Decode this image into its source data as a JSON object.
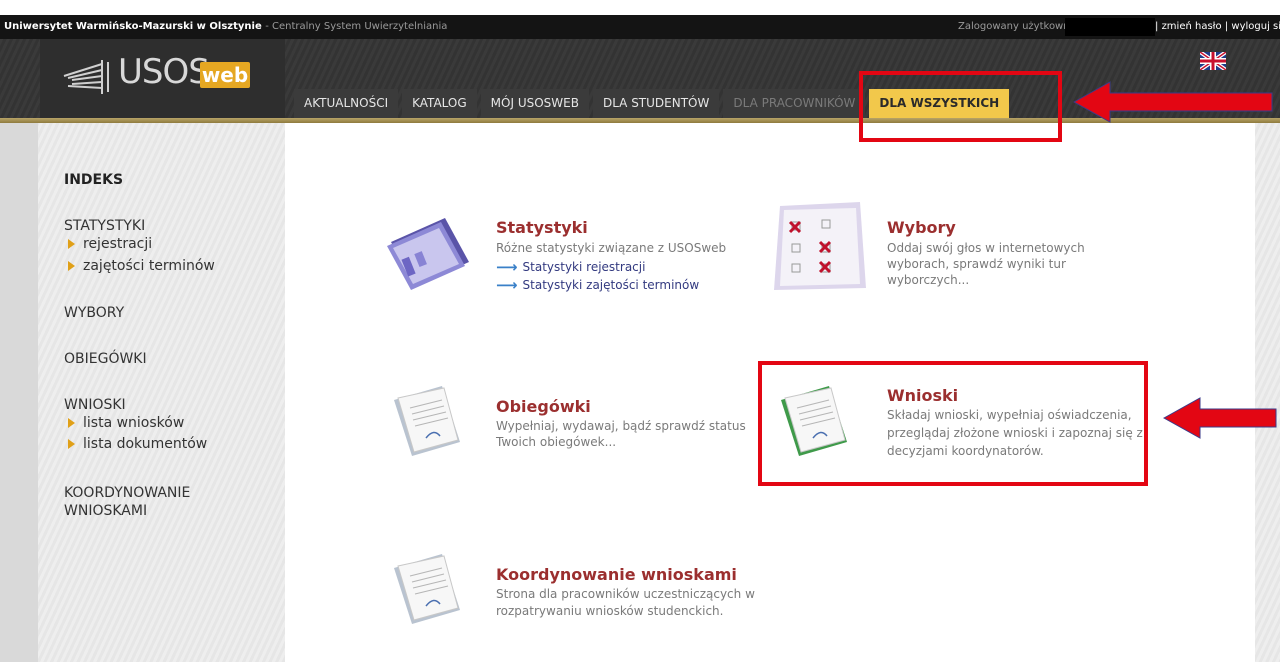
{
  "topbar": {
    "university": "Uniwersytet Warmińsko-Mazurski w Olsztynie",
    "system": "- Centralny System Uwierzytelniania",
    "logged_user": "Zalogowany użytkownik",
    "change_password": "zmień hasło",
    "separator": "|",
    "logout": "wyloguj się"
  },
  "logo": {
    "text": "USOS",
    "badge": "web"
  },
  "tabs": [
    {
      "label": "AKTUALNOŚCI"
    },
    {
      "label": "KATALOG"
    },
    {
      "label": "MÓJ USOSWEB"
    },
    {
      "label": "DLA STUDENTÓW"
    },
    {
      "label": "DLA PRACOWNIKÓW"
    },
    {
      "label": "DLA WSZYSTKICH"
    }
  ],
  "sidebar": {
    "title": "INDEKS",
    "statystyki": "STATYSTYKI",
    "stat_items": [
      "rejestracji",
      "zajętości terminów"
    ],
    "wybory": "WYBORY",
    "obiegowki": "OBIEGÓWKI",
    "wnioski": "WNIOSKI",
    "wnioski_items": [
      "lista wniosków",
      "lista dokumentów"
    ],
    "koordynowanie_1": "KOORDYNOWANIE",
    "koordynowanie_2": "WNIOSKAMI"
  },
  "cards": {
    "statystyki": {
      "title": "Statystyki",
      "desc": "Różne statystyki związane z USOSweb",
      "link1": "Statystyki rejestracji",
      "link2": "Statystyki zajętości terminów"
    },
    "wybory": {
      "title": "Wybory",
      "desc1": "Oddaj swój głos w internetowych",
      "desc2": "wyborach, sprawdź wyniki tur",
      "desc3": "wyborczych..."
    },
    "obiegowki": {
      "title": "Obiegówki",
      "desc1": "Wypełniaj, wydawaj, bądź sprawdź status",
      "desc2": "Twoich obiegówek..."
    },
    "wnioski": {
      "title": "Wnioski",
      "desc1": "Składaj wnioski, wypełniaj oświadczenia,",
      "desc2": "przeglądaj złożone wnioski i zapoznaj się z",
      "desc3": "decyzjami koordynatorów."
    },
    "koordynowanie": {
      "title": "Koordynowanie wnioskami",
      "desc1": "Strona dla pracowników uczestniczących w",
      "desc2": "rozpatrywaniu wniosków studenckich."
    }
  },
  "colors": {
    "highlight": "#e30613",
    "active_tab": "#f2c84b",
    "card_title": "#9b2f2f",
    "link": "#333a80"
  }
}
